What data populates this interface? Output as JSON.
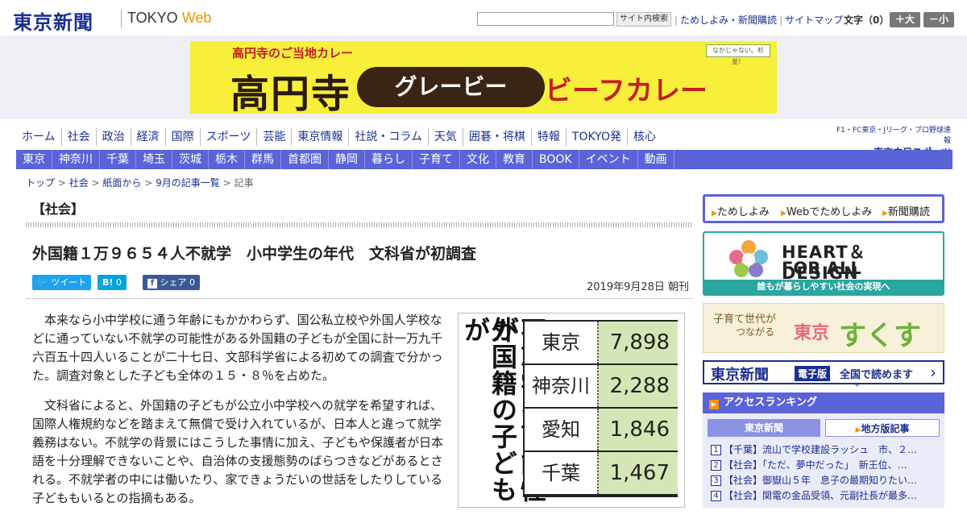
{
  "header": {
    "logo_jp": "東京新聞",
    "logo_en_a": "TOKYO ",
    "logo_en_b": "Web",
    "search_button": "サイト内検索",
    "link_trial": "ためしよみ・新聞購読",
    "link_sitemap": "サイトマップ",
    "font_label": "文字（0）",
    "font_larger": "＋大",
    "font_smaller": "－小"
  },
  "banner": {
    "sub": "高円寺のご当地カレー",
    "main1": "高円寺",
    "pill": "グレービー",
    "main2": "ビーフカレー",
    "stamp": "なかじゃない。杉並！"
  },
  "nav_main": [
    "ホーム",
    "社会",
    "政治",
    "経済",
    "国際",
    "スポーツ",
    "芸能",
    "東京情報",
    "社説・コラム",
    "天気",
    "囲碁・将棋",
    "特報",
    "TOKYO発",
    "核心"
  ],
  "sports_link": {
    "line1": "F1・FC東京・Jリーグ・プロ野球速報",
    "line2": "東京中日スポーツ"
  },
  "nav_region": [
    "東京",
    "神奈川",
    "千葉",
    "埼玉",
    "茨城",
    "栃木",
    "群馬",
    "首都圏",
    "静岡",
    "暮らし",
    "子育て",
    "文化",
    "教育",
    "BOOK",
    "イベント",
    "動画"
  ],
  "breadcrumb": [
    "トップ",
    "社会",
    "紙面から",
    "9月の記事一覧",
    "記事"
  ],
  "section_label": "【社会】",
  "article": {
    "headline": "外国籍１万９６５４人不就学　小中学生の年代　文科省が初調査",
    "share_tweet": "ツイート",
    "share_hatena": "0",
    "share_fb": "シェア 0",
    "date": "2019年9月28日 朝刊",
    "paragraphs": [
      "本来なら小中学校に通う年齢にもかかわらず、国公私立校や外国人学校などに通っていない不就学の可能性がある外国籍の子どもが全国に計一万九千六百五十四人いることが二十七日、文部科学省による初めての調査で分かった。調査対象とした子ども全体の１５・８％を占めた。",
      "文科省によると、外国籍の子どもが公立小中学校への就学を希望すれば、国際人権規約などを踏まえて無償で受け入れているが、日本人と違って就学義務はない。不就学の背景にはこうした事情に加え、子どもや保護者が日本語を十分理解できないことや、自治体の支援態勢のばらつきなどがあるとされる。不就学者の中には働いたり、家できょうだいの世話をしたりしている子どももいるとの指摘もある。"
    ]
  },
  "figure": {
    "title_col1": "不就学の可能性が",
    "title_col2": "外国籍の子どもが",
    "rows": [
      {
        "name": "東京",
        "value": "7,898"
      },
      {
        "name": "神奈川",
        "value": "2,288"
      },
      {
        "name": "愛知",
        "value": "1,846"
      },
      {
        "name": "千葉",
        "value": "1,467"
      }
    ]
  },
  "sidebar": {
    "links": [
      "ためしよみ",
      "Webでためしよみ",
      "新聞購読"
    ],
    "hd_line1": "HEART＆DESIGN",
    "hd_line2": "FOR ALL",
    "hd_bar": "誰もが暮らしやすい社会の実現へ",
    "sk_1": "子育て世代が",
    "sk_2": "つながる",
    "sk_3": "東京",
    "sk_4": "すくすく",
    "ed_1": "東京新聞",
    "ed_2": "電子版",
    "ed_3": "全国で読めます",
    "ed_arrow": "›",
    "ranking_title": "アクセスランキング",
    "tab_tokyo": "東京新聞",
    "tab_local": "地方版記事",
    "ranking": [
      "【千葉】流山で学校建設ラッシュ　市、２…",
      "【社会】「ただ、夢中だった」　新王位、…",
      "【社会】御嶽山５年　息子の最期知りたい…",
      "【社会】関電の金品受領、元副社長が最多…"
    ]
  }
}
